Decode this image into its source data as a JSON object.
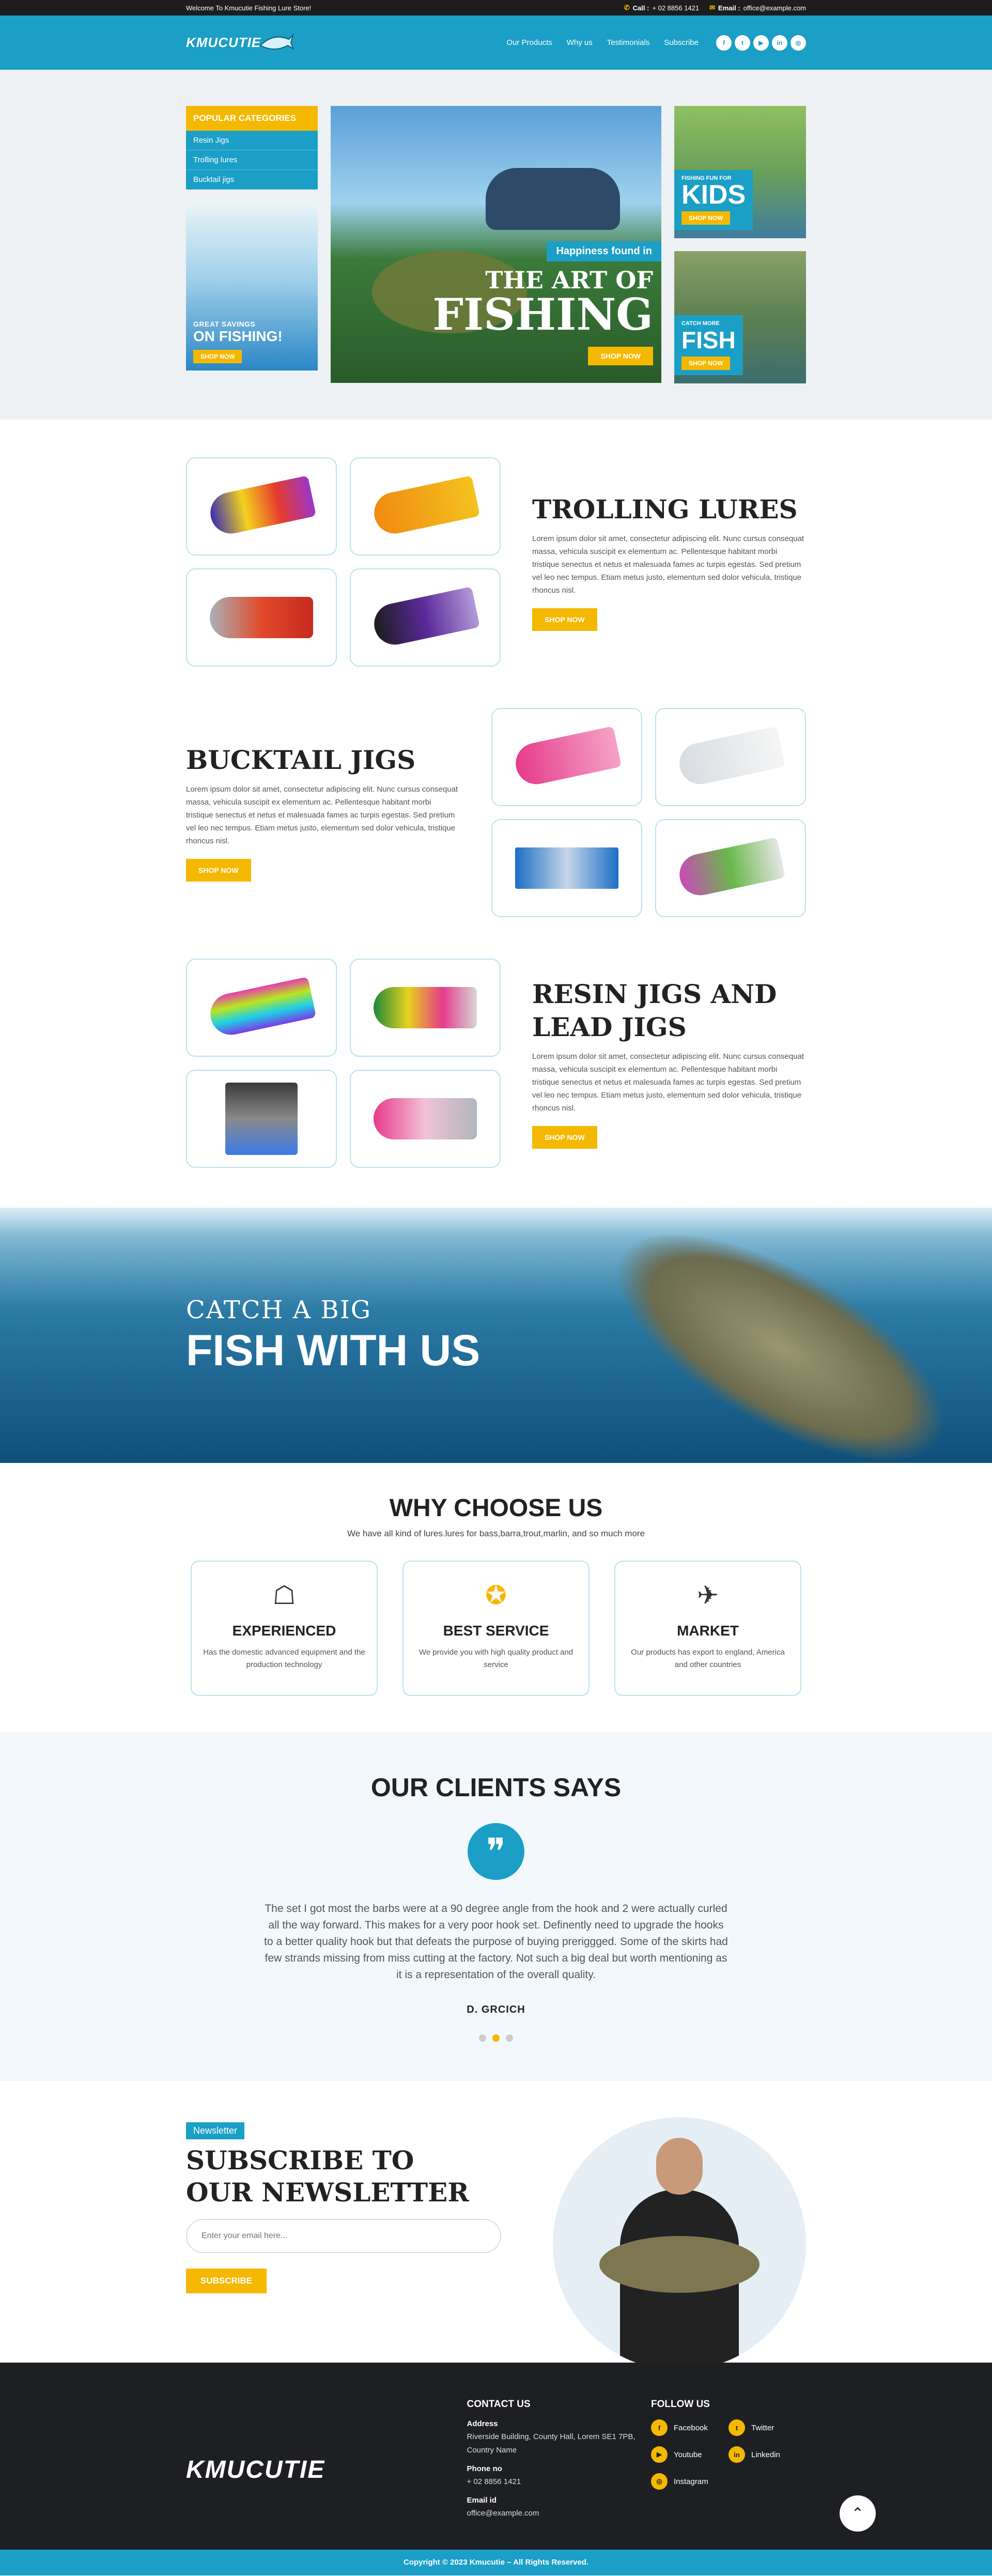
{
  "topbar": {
    "welcome": "Welcome To Kmucutie Fishing Lure Store!",
    "call_label": "Call :",
    "phone": "+ 02 8856 1421",
    "email_label": "Email :",
    "email": "office@example.com"
  },
  "header": {
    "brand": "KMUCUTIE",
    "nav": [
      "Our Products",
      "Why us",
      "Testimonials",
      "Subscribe"
    ],
    "socials": [
      {
        "icon": "facebook-icon",
        "glyph": "f"
      },
      {
        "icon": "twitter-icon",
        "glyph": "t"
      },
      {
        "icon": "youtube-icon",
        "glyph": "▶"
      },
      {
        "icon": "linkedin-icon",
        "glyph": "in"
      },
      {
        "icon": "instagram-icon",
        "glyph": "◎"
      }
    ]
  },
  "hero": {
    "categories_title": "POPULAR CATEGORIES",
    "categories": [
      "Resin Jigs",
      "Trolling lures",
      "Bucktail jigs"
    ],
    "savings_small": "GREAT SAVINGS",
    "savings_big": "ON FISHING!",
    "shop_now": "SHOP NOW",
    "main_tag": "Happiness found in",
    "main_line1": "THE ART OF",
    "main_line2": "FISHING",
    "kids_small": "FISHING FUN FOR",
    "kids_big": "KIDS",
    "catch_small": "CATCH MORE",
    "catch_big": "FISH"
  },
  "products": [
    {
      "title": "TROLLING LURES",
      "text": "Lorem ipsum dolor sit amet, consectetur adipiscing elit. Nunc cursus consequat massa, vehicula suscipit ex elementum ac. Pellentesque habitant morbi tristique senectus et netus et malesuada fames ac turpis egestas. Sed pretium vel leo nec tempus. Etiam metus justo, elementum sed dolor vehicula, tristique rhoncus nisl.",
      "button": "SHOP NOW"
    },
    {
      "title": "BUCKTAIL JIGS",
      "text": "Lorem ipsum dolor sit amet, consectetur adipiscing elit. Nunc cursus consequat massa, vehicula suscipit ex elementum ac. Pellentesque habitant morbi tristique senectus et netus et malesuada fames ac turpis egestas. Sed pretium vel leo nec tempus. Etiam metus justo, elementum sed dolor vehicula, tristique rhoncus nisl.",
      "button": "SHOP NOW"
    },
    {
      "title_line1": "RESIN JIGS AND",
      "title_line2": "LEAD JIGS",
      "text": "Lorem ipsum dolor sit amet, consectetur adipiscing elit. Nunc cursus consequat massa, vehicula suscipit ex elementum ac. Pellentesque habitant morbi tristique senectus et netus et malesuada fames ac turpis egestas. Sed pretium vel leo nec tempus. Etiam metus justo, elementum sed dolor vehicula, tristique rhoncus nisl.",
      "button": "SHOP NOW"
    }
  ],
  "catch_banner": {
    "line1": "CATCH A BIG",
    "line2": "FISH WITH US"
  },
  "why": {
    "title": "WHY CHOOSE US",
    "subtitle": "We have all kind of lures.lures for bass,barra,trout,marlin, and so much more",
    "cards": [
      {
        "icon": "experience-sign-icon",
        "glyph": "☖",
        "title": "EXPERIENCED",
        "text": "Has the domestic advanced equipment and the production technology"
      },
      {
        "icon": "award-ribbon-icon",
        "glyph": "✪",
        "title": "BEST SERVICE",
        "text": "We provide you with high quality product and service"
      },
      {
        "icon": "paper-plane-icon",
        "glyph": "✈",
        "title": "MARKET",
        "text": "Our products has export to england, America and other countries"
      }
    ]
  },
  "clients": {
    "title": "OUR CLIENTS SAYS",
    "quote": "The set I got most the barbs were at a 90 degree angle from the hook and 2 were actually curled all the way forward. This makes for a very poor hook set. Definently need to upgrade the hooks to a better quality hook but that defeats the purpose of buying preriggged. Some of the skirts had few strands missing from miss cutting at the factory. Not such a big deal but worth mentioning as it is a representation of the overall quality.",
    "author": "D. GRCICH"
  },
  "newsletter": {
    "tag": "Newsletter",
    "title_line1": "SUBSCRIBE TO",
    "title_line2": "OUR NEWSLETTER",
    "placeholder": "Enter your email here...",
    "button": "SUBSCRIBE"
  },
  "footer": {
    "brand": "KMUCUTIE",
    "contact_title": "CONTACT US",
    "address_label": "Address",
    "address": "Riverside Building, County Hall, Lorem SE1 7PB, Country Name",
    "phone_label": "Phone no",
    "phone": "+ 02 8856 1421",
    "email_label": "Email id",
    "email": "office@example.com",
    "follow_title": "FOLLOW US",
    "follow": [
      {
        "icon": "facebook-icon",
        "glyph": "f",
        "label": "Facebook"
      },
      {
        "icon": "twitter-icon",
        "glyph": "t",
        "label": "Twitter"
      },
      {
        "icon": "youtube-icon",
        "glyph": "▶",
        "label": "Youtube"
      },
      {
        "icon": "linkedin-icon",
        "glyph": "in",
        "label": "Linkedin"
      },
      {
        "icon": "instagram-icon",
        "glyph": "◎",
        "label": "Instagram"
      }
    ],
    "copyright": "Copyright © 2023 Kmucutie – All Rights Reserved."
  },
  "colors": {
    "accent": "#1b9fc6",
    "cta": "#f5b800",
    "dark": "#1e1f22"
  }
}
